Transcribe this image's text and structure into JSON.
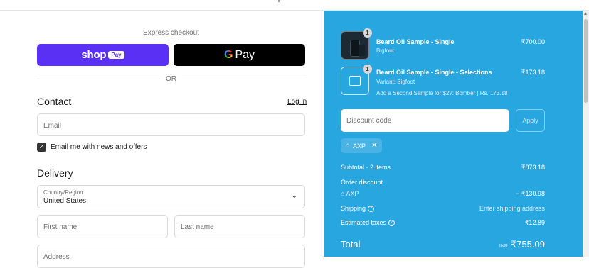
{
  "express": {
    "title": "Express checkout",
    "shop_pay_word": "shop",
    "shop_pay_badge": "Pay",
    "gpay_g": "G",
    "gpay_label": "Pay",
    "or_label": "OR"
  },
  "contact": {
    "heading": "Contact",
    "login_link": "Log in",
    "email_placeholder": "Email",
    "newsletter_label": "Email me with news and offers",
    "newsletter_checked": true
  },
  "delivery": {
    "heading": "Delivery",
    "country_label": "Country/Region",
    "country_value": "United States",
    "first_name_placeholder": "First name",
    "last_name_placeholder": "Last name",
    "address_placeholder": "Address"
  },
  "cart": {
    "items": [
      {
        "name": "Beard Oil Sample - Single",
        "variant": "Bigfoot",
        "price": "₹700.00",
        "qty": "1"
      },
      {
        "name": "Beard Oil Sample - Single - Selections",
        "variant": "Variant: Bigfoot",
        "extra": "Add a Second Sample for $2?: Bomber | Rs. 173.18",
        "price": "₹173.18",
        "qty": "1"
      }
    ],
    "discount_placeholder": "Discount code",
    "apply_label": "Apply",
    "applied_code": "AXP"
  },
  "summary": {
    "subtotal_label": "Subtotal · 2 items",
    "subtotal_value": "₹873.18",
    "order_discount_label": "Order discount",
    "discount_code": "AXP",
    "discount_value": "− ₹130.98",
    "shipping_label": "Shipping",
    "shipping_value": "Enter shipping address",
    "taxes_label": "Estimated taxes",
    "taxes_value": "₹12.89",
    "total_label": "Total",
    "total_currency": "INR",
    "total_value": "₹755.09"
  },
  "colors": {
    "shop_pay": "#5a31f4",
    "summary_bg": "#28a6e0"
  }
}
